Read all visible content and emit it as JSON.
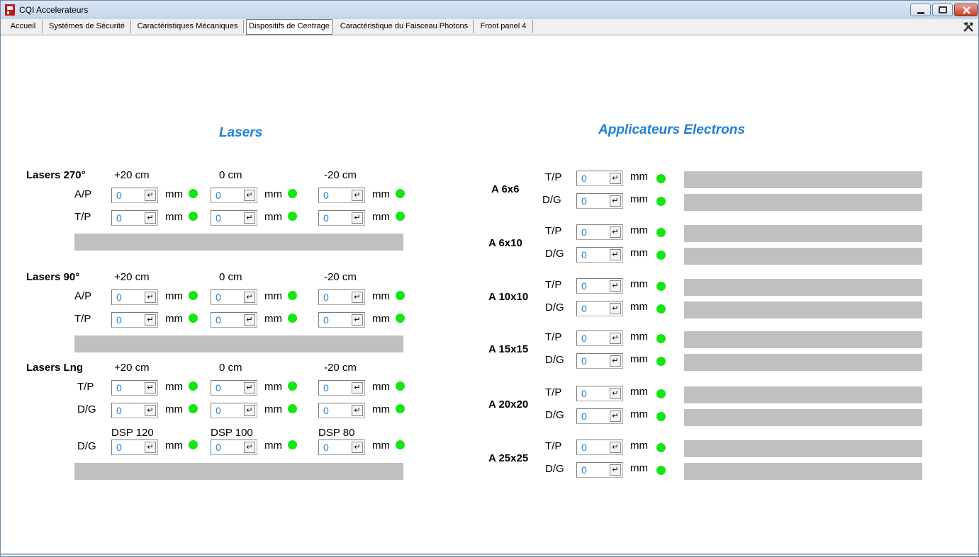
{
  "window": {
    "title": "CQI Accelerateurs",
    "tabs": [
      "Accueil",
      "Systémes de Sécurité",
      "Caractéristiques Mécaniques",
      "Dispositifs de Centrage",
      "Caractéristique du Faisceau Photons",
      "Front panel 4"
    ],
    "active_tab": "Dispositifs de Centrage"
  },
  "colors": {
    "accent": "#1e7fd8",
    "led_on": "#14e614",
    "status_bar": "#c0c0c0"
  },
  "icons": [
    "app-icon",
    "minimize-icon",
    "maximize-icon",
    "close-icon",
    "tools-icon",
    "enter-icon"
  ],
  "lasers": {
    "title": "Lasers",
    "unit": "mm",
    "groups": [
      {
        "name": "Lasers 270°",
        "positions": [
          "+20 cm",
          "0 cm",
          "-20 cm"
        ],
        "rows": [
          {
            "label": "A/P",
            "values": [
              "0",
              "0",
              "0"
            ]
          },
          {
            "label": "T/P",
            "values": [
              "0",
              "0",
              "0"
            ]
          }
        ]
      },
      {
        "name": "Lasers 90°",
        "positions": [
          "+20 cm",
          "0 cm",
          "-20 cm"
        ],
        "rows": [
          {
            "label": "A/P",
            "values": [
              "0",
              "0",
              "0"
            ]
          },
          {
            "label": "T/P",
            "values": [
              "0",
              "0",
              "0"
            ]
          }
        ]
      },
      {
        "name": "Lasers Lng",
        "positions": [
          "+20 cm",
          "0 cm",
          "-20 cm"
        ],
        "rows": [
          {
            "label": "T/P",
            "values": [
              "0",
              "0",
              "0"
            ]
          },
          {
            "label": "D/G",
            "values": [
              "0",
              "0",
              "0"
            ]
          }
        ],
        "dsp_positions": [
          "DSP 120",
          "DSP 100",
          "DSP 80"
        ],
        "dsp_row": {
          "label": "D/G",
          "values": [
            "0",
            "0",
            "0"
          ]
        }
      }
    ]
  },
  "applicators": {
    "title": "Applicateurs Electrons",
    "unit": "mm",
    "items": [
      {
        "name": "A 6x6",
        "rows": [
          {
            "label": "T/P",
            "value": "0"
          },
          {
            "label": "D/G",
            "value": "0"
          }
        ]
      },
      {
        "name": "A 6x10",
        "rows": [
          {
            "label": "T/P",
            "value": "0"
          },
          {
            "label": "D/G",
            "value": "0"
          }
        ]
      },
      {
        "name": "A 10x10",
        "rows": [
          {
            "label": "T/P",
            "value": "0"
          },
          {
            "label": "D/G",
            "value": "0"
          }
        ]
      },
      {
        "name": "A 15x15",
        "rows": [
          {
            "label": "T/P",
            "value": "0"
          },
          {
            "label": "D/G",
            "value": "0"
          }
        ]
      },
      {
        "name": "A 20x20",
        "rows": [
          {
            "label": "T/P",
            "value": "0"
          },
          {
            "label": "D/G",
            "value": "0"
          }
        ]
      },
      {
        "name": "A 25x25",
        "rows": [
          {
            "label": "T/P",
            "value": "0"
          },
          {
            "label": "D/G",
            "value": "0"
          }
        ]
      }
    ]
  }
}
